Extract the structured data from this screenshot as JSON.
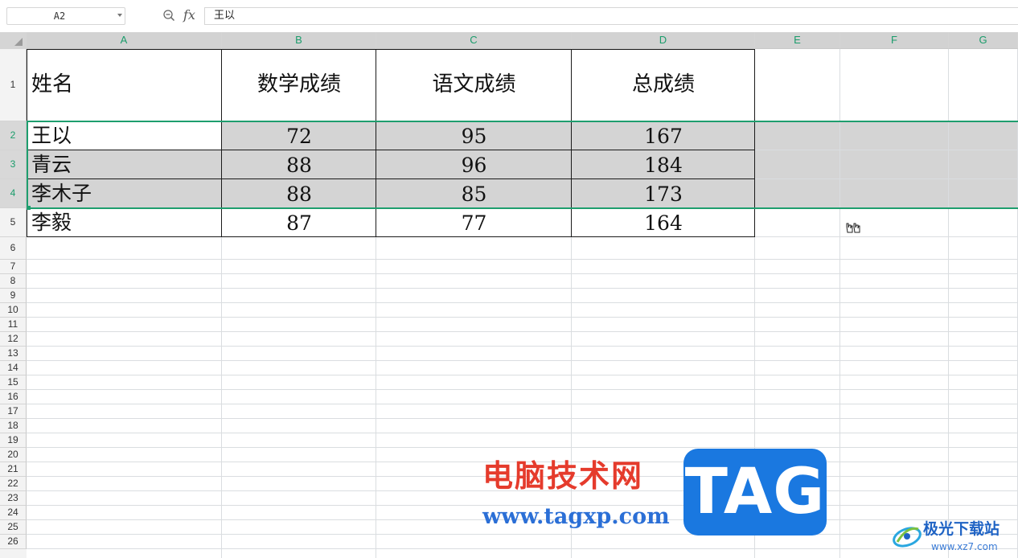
{
  "formula_bar": {
    "name_box": "A2",
    "fx_label": "fx",
    "formula_value": "王以"
  },
  "columns": [
    "A",
    "B",
    "C",
    "D",
    "E",
    "F",
    "G"
  ],
  "rows": [
    "1",
    "2",
    "3",
    "4",
    "5",
    "6",
    "7",
    "8",
    "9",
    "10",
    "11",
    "12",
    "13",
    "14",
    "15",
    "16",
    "17",
    "18",
    "19",
    "20",
    "21",
    "22",
    "23",
    "24",
    "25",
    "26"
  ],
  "table": {
    "headers": [
      "姓名",
      "数学成绩",
      "语文成绩",
      "总成绩"
    ],
    "rows": [
      {
        "name": "王以",
        "math": "72",
        "chinese": "95",
        "total": "167"
      },
      {
        "name": "青云",
        "math": "88",
        "chinese": "96",
        "total": "184"
      },
      {
        "name": "李木子",
        "math": "88",
        "chinese": "85",
        "total": "173"
      },
      {
        "name": "李毅",
        "math": "87",
        "chinese": "77",
        "total": "164"
      }
    ]
  },
  "selection": {
    "active_cell": "A2",
    "selected_rows": [
      "2",
      "3",
      "4"
    ]
  },
  "watermark": {
    "site_name": "电脑技术网",
    "site_url": "www.tagxp.com",
    "tag": "TAG",
    "corner_title": "极光下载站",
    "corner_url": "www.xz7.com"
  },
  "colors": {
    "accent_green": "#1e9e6e",
    "selection_gray": "#d4d4d4",
    "watermark_red": "#e53b2c",
    "watermark_blue": "#1a78e0"
  },
  "icons": {
    "zoom": "zoom-icon",
    "function": "fx-icon",
    "dropdown": "chevron-down-icon",
    "select_all": "select-all-icon",
    "cursor": "hand-cursor-icon"
  }
}
